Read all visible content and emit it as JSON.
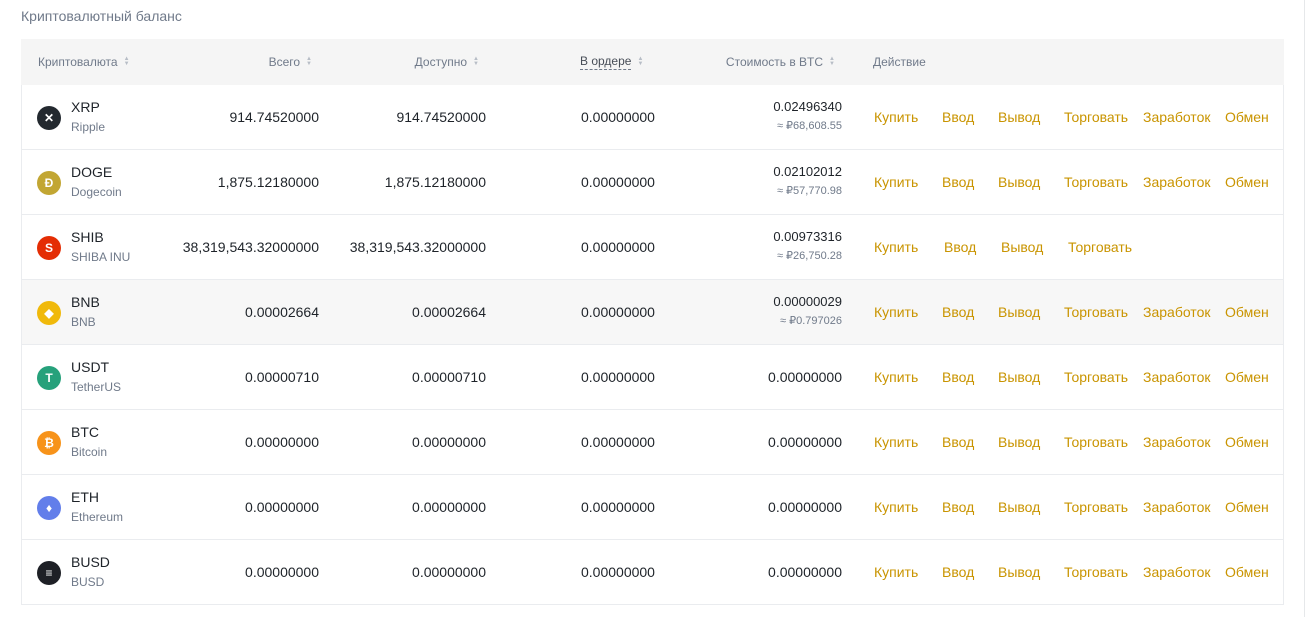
{
  "title": "Криптовалютный баланс",
  "headers": {
    "coin": "Криптовалюта",
    "total": "Всего",
    "available": "Доступно",
    "in_order": "В ордере",
    "btc_value": "Стоимость в BTC",
    "action": "Действие"
  },
  "actions": {
    "buy": "Купить",
    "deposit": "Ввод",
    "withdraw": "Вывод",
    "trade": "Торговать",
    "earn": "Заработок",
    "convert": "Обмен"
  },
  "rows": [
    {
      "symbol": "XRP",
      "name": "Ripple",
      "total": "914.74520000",
      "available": "914.74520000",
      "in_order": "0.00000000",
      "btc": "0.02496340",
      "rub": "≈ ₽68,608.55",
      "icon": "xrp-icon",
      "color": "#23292f",
      "glyph": "✕"
    },
    {
      "symbol": "DOGE",
      "name": "Dogecoin",
      "total": "1,875.12180000",
      "available": "1,875.12180000",
      "in_order": "0.00000000",
      "btc": "0.02102012",
      "rub": "≈ ₽57,770.98",
      "icon": "doge-icon",
      "color": "#c2a633",
      "glyph": "Ð"
    },
    {
      "symbol": "SHIB",
      "name": "SHIBA INU",
      "total": "38,319,543.32000000",
      "available": "38,319,543.32000000",
      "in_order": "0.00000000",
      "btc": "0.00973316",
      "rub": "≈ ₽26,750.28",
      "icon": "shib-icon",
      "color": "#e42d04",
      "glyph": "S"
    },
    {
      "symbol": "BNB",
      "name": "BNB",
      "total": "0.00002664",
      "available": "0.00002664",
      "in_order": "0.00000000",
      "btc": "0.00000029",
      "rub": "≈ ₽0.797026",
      "icon": "bnb-icon",
      "color": "#f0b90b",
      "glyph": "◆"
    },
    {
      "symbol": "USDT",
      "name": "TetherUS",
      "total": "0.00000710",
      "available": "0.00000710",
      "in_order": "0.00000000",
      "btc": "0.00000000",
      "rub": "",
      "icon": "usdt-icon",
      "color": "#26a17b",
      "glyph": "T"
    },
    {
      "symbol": "BTC",
      "name": "Bitcoin",
      "total": "0.00000000",
      "available": "0.00000000",
      "in_order": "0.00000000",
      "btc": "0.00000000",
      "rub": "",
      "icon": "btc-icon",
      "color": "#f7931a",
      "glyph": "₿"
    },
    {
      "symbol": "ETH",
      "name": "Ethereum",
      "total": "0.00000000",
      "available": "0.00000000",
      "in_order": "0.00000000",
      "btc": "0.00000000",
      "rub": "",
      "icon": "eth-icon",
      "color": "#627eea",
      "glyph": "♦"
    },
    {
      "symbol": "BUSD",
      "name": "BUSD",
      "total": "0.00000000",
      "available": "0.00000000",
      "in_order": "0.00000000",
      "btc": "0.00000000",
      "rub": "",
      "icon": "busd-icon",
      "color": "#1e2026",
      "glyph": "≡"
    }
  ],
  "row_actions": [
    [
      "buy",
      "deposit",
      "withdraw",
      "trade",
      "earn",
      "convert"
    ],
    [
      "buy",
      "deposit",
      "withdraw",
      "trade",
      "earn",
      "convert"
    ],
    [
      "buy",
      "deposit",
      "withdraw",
      "trade"
    ],
    [
      "buy",
      "deposit",
      "withdraw",
      "trade",
      "earn",
      "convert"
    ],
    [
      "buy",
      "deposit",
      "withdraw",
      "trade",
      "earn",
      "convert"
    ],
    [
      "buy",
      "deposit",
      "withdraw",
      "trade",
      "earn",
      "convert"
    ],
    [
      "buy",
      "deposit",
      "withdraw",
      "trade",
      "earn",
      "convert"
    ],
    [
      "buy",
      "deposit",
      "withdraw",
      "trade",
      "earn",
      "convert"
    ]
  ],
  "highlighted_row": 3
}
